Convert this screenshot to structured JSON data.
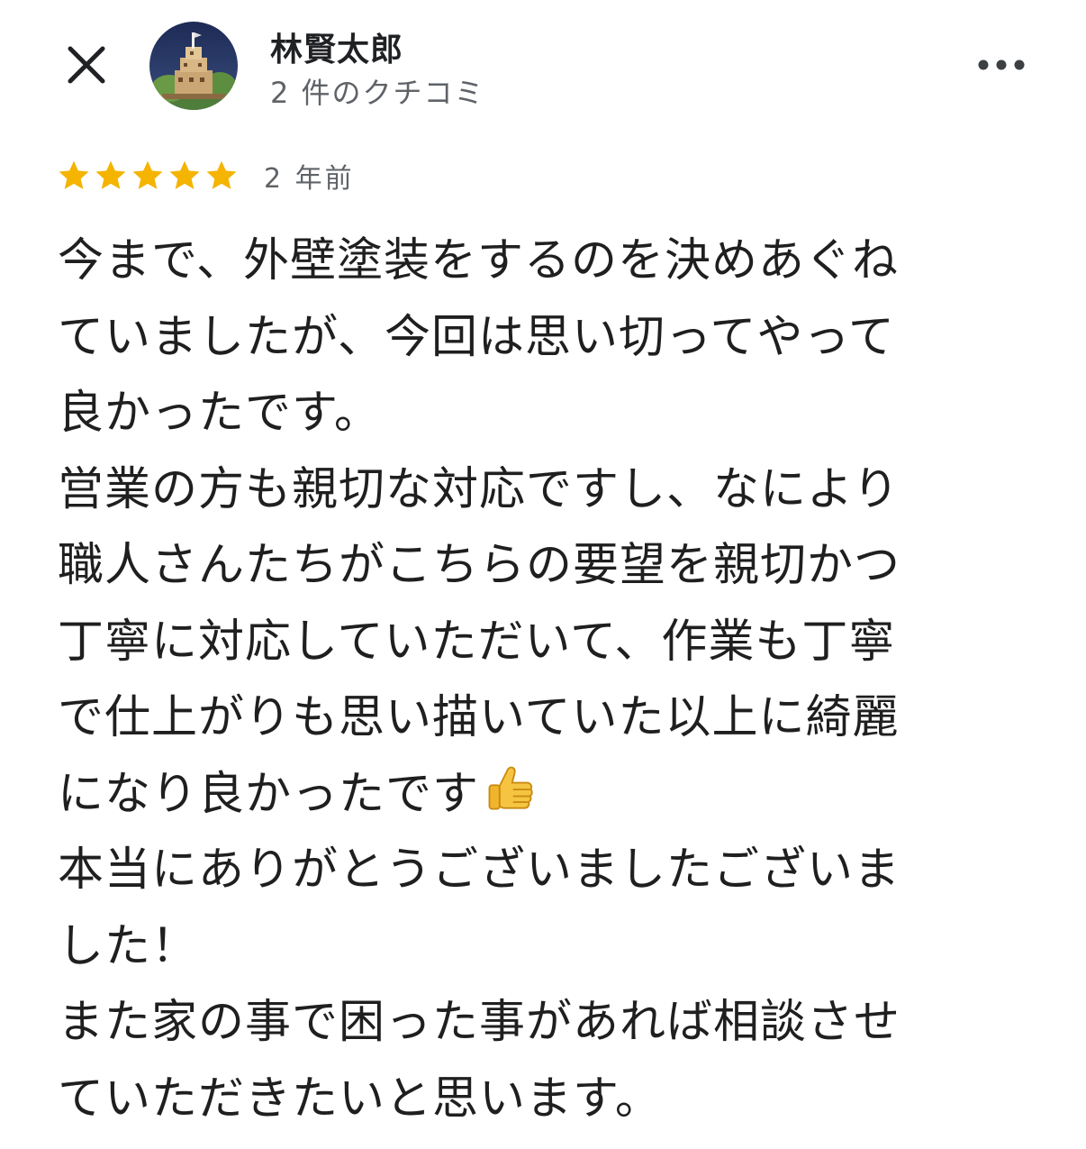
{
  "reviewer": {
    "name": "林賢太郎",
    "review_count": "2 件のクチコミ"
  },
  "icons": {
    "close": "close-icon",
    "more": "more-horizontal-icon",
    "star": "star-icon",
    "thumbs_up": "thumbs-up-emoji"
  },
  "review": {
    "rating": 5,
    "max_rating": 5,
    "date": "2 年前",
    "lines": [
      "今まで、外壁塗装をするのを決めあぐね",
      "ていましたが、今回は思い切ってやって",
      "良かったです。",
      "営業の方も親切な対応ですし、なにより",
      "職人さんたちがこちらの要望を親切かつ",
      "丁寧に対応していただいて、作業も丁寧",
      "で仕上がりも思い描いていた以上に綺麗",
      "になり良かったです",
      "本当にありがとうございましたございま",
      "した！",
      "また家の事で困った事があれば相談させ",
      "ていただきたいと思います。"
    ]
  },
  "colors": {
    "star": "#f4b400",
    "secondary_text": "#5f6368",
    "primary_text": "#1f1f1f"
  }
}
